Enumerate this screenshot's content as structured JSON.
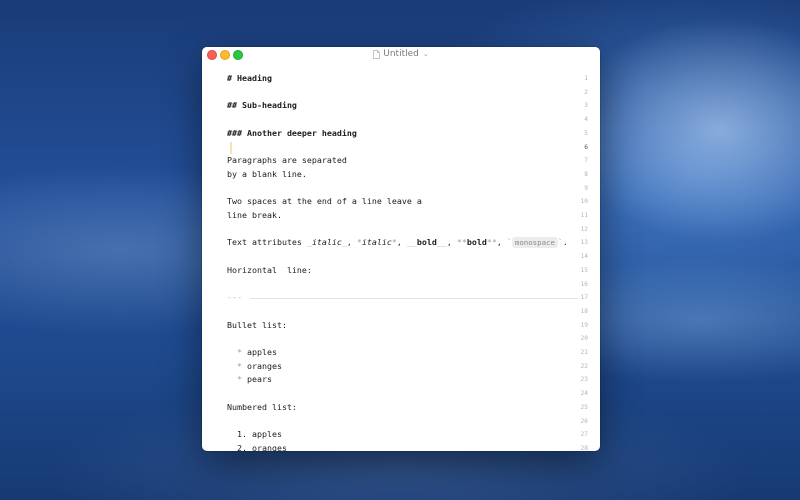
{
  "window": {
    "title": "Untitled",
    "chevron": "⌄",
    "icons": {
      "close": "close-dot",
      "minimize": "minimize-dot",
      "zoom": "zoom-dot",
      "document": "document-icon"
    },
    "colors": {
      "close": "#fc5f57",
      "minimize": "#fdbc2e",
      "zoom": "#28c840",
      "caret": "#f7e3b0"
    }
  },
  "editor": {
    "current_line": 6,
    "line_numbers": [
      "1",
      "2",
      "3",
      "4",
      "5",
      "6",
      "7",
      "8",
      "9",
      "10",
      "11",
      "12",
      "13",
      "14",
      "15",
      "16",
      "17",
      "18",
      "19",
      "20",
      "21",
      "22",
      "23",
      "24",
      "25",
      "26",
      "27",
      "28"
    ],
    "lines": {
      "l1": "# Heading",
      "l3": "## Sub-heading",
      "l5": "### Another deeper heading",
      "l7": "Paragraphs are separated",
      "l8": "by a blank line.",
      "l10": "Two spaces at the end of a line leave a",
      "l11": "line break.",
      "l13": {
        "prefix": "Text attributes ",
        "italic_open": "_",
        "italic": "italic",
        "italic_close": "_",
        "sep1": ", ",
        "italic2_open": "*",
        "italic2": "italic",
        "italic2_close": "*",
        "sep2": ", ",
        "bold_open": "__",
        "bold": "bold",
        "bold_close": "__",
        "sep3": ", ",
        "bold2_open": "**",
        "bold2": "bold",
        "bold2_close": "**",
        "sep4": ", ",
        "code_open": "`",
        "code": "monospace",
        "code_close": "`",
        "end": "."
      },
      "l15": "Horizontal  line:",
      "l17": "---",
      "l19": "Bullet list:",
      "l21": {
        "marker": "*",
        "text": "apples"
      },
      "l22": {
        "marker": "*",
        "text": "oranges"
      },
      "l23": {
        "marker": "*",
        "text": "pears"
      },
      "l25": "Numbered list:",
      "l27": {
        "marker": "1.",
        "text": "apples"
      },
      "l28": {
        "marker": "2.",
        "text": "oranges"
      }
    }
  }
}
